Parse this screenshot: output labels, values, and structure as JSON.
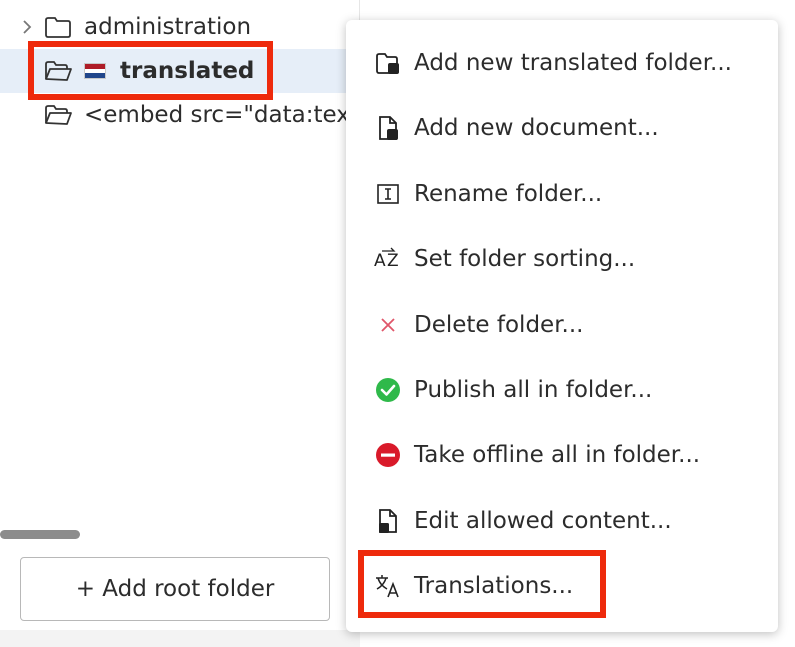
{
  "tree": {
    "items": [
      {
        "label": "administration",
        "icon": "folder-icon"
      },
      {
        "label": "translated",
        "icon": "folder-open-icon",
        "flag": "netherlands-flag-icon"
      },
      {
        "label": "<embed src=\"data:tex",
        "icon": "folder-open-icon"
      }
    ],
    "add_root_label": "+ Add root folder",
    "selected_bg": "#e6eef8"
  },
  "menu": {
    "items": [
      {
        "label": "Add new translated folder...",
        "icon": "add-folder-icon"
      },
      {
        "label": "Add new document...",
        "icon": "add-document-icon"
      },
      {
        "label": "Rename folder...",
        "icon": "rename-icon"
      },
      {
        "label": "Set folder sorting...",
        "icon": "sort-az-icon"
      },
      {
        "label": "Delete folder...",
        "icon": "delete-x-icon"
      },
      {
        "label": "Publish all in folder...",
        "icon": "publish-check-icon"
      },
      {
        "label": "Take offline all in folder...",
        "icon": "offline-minus-icon"
      },
      {
        "label": "Edit allowed content...",
        "icon": "allowed-content-icon"
      },
      {
        "label": "Translations...",
        "icon": "translate-icon"
      }
    ]
  },
  "colors": {
    "highlight": "#ee2a0c",
    "publish": "#2fb94a",
    "offline": "#d91a2a",
    "delete": "#e0566a",
    "flag_red": "#ae1c28",
    "flag_blue": "#21468b"
  }
}
